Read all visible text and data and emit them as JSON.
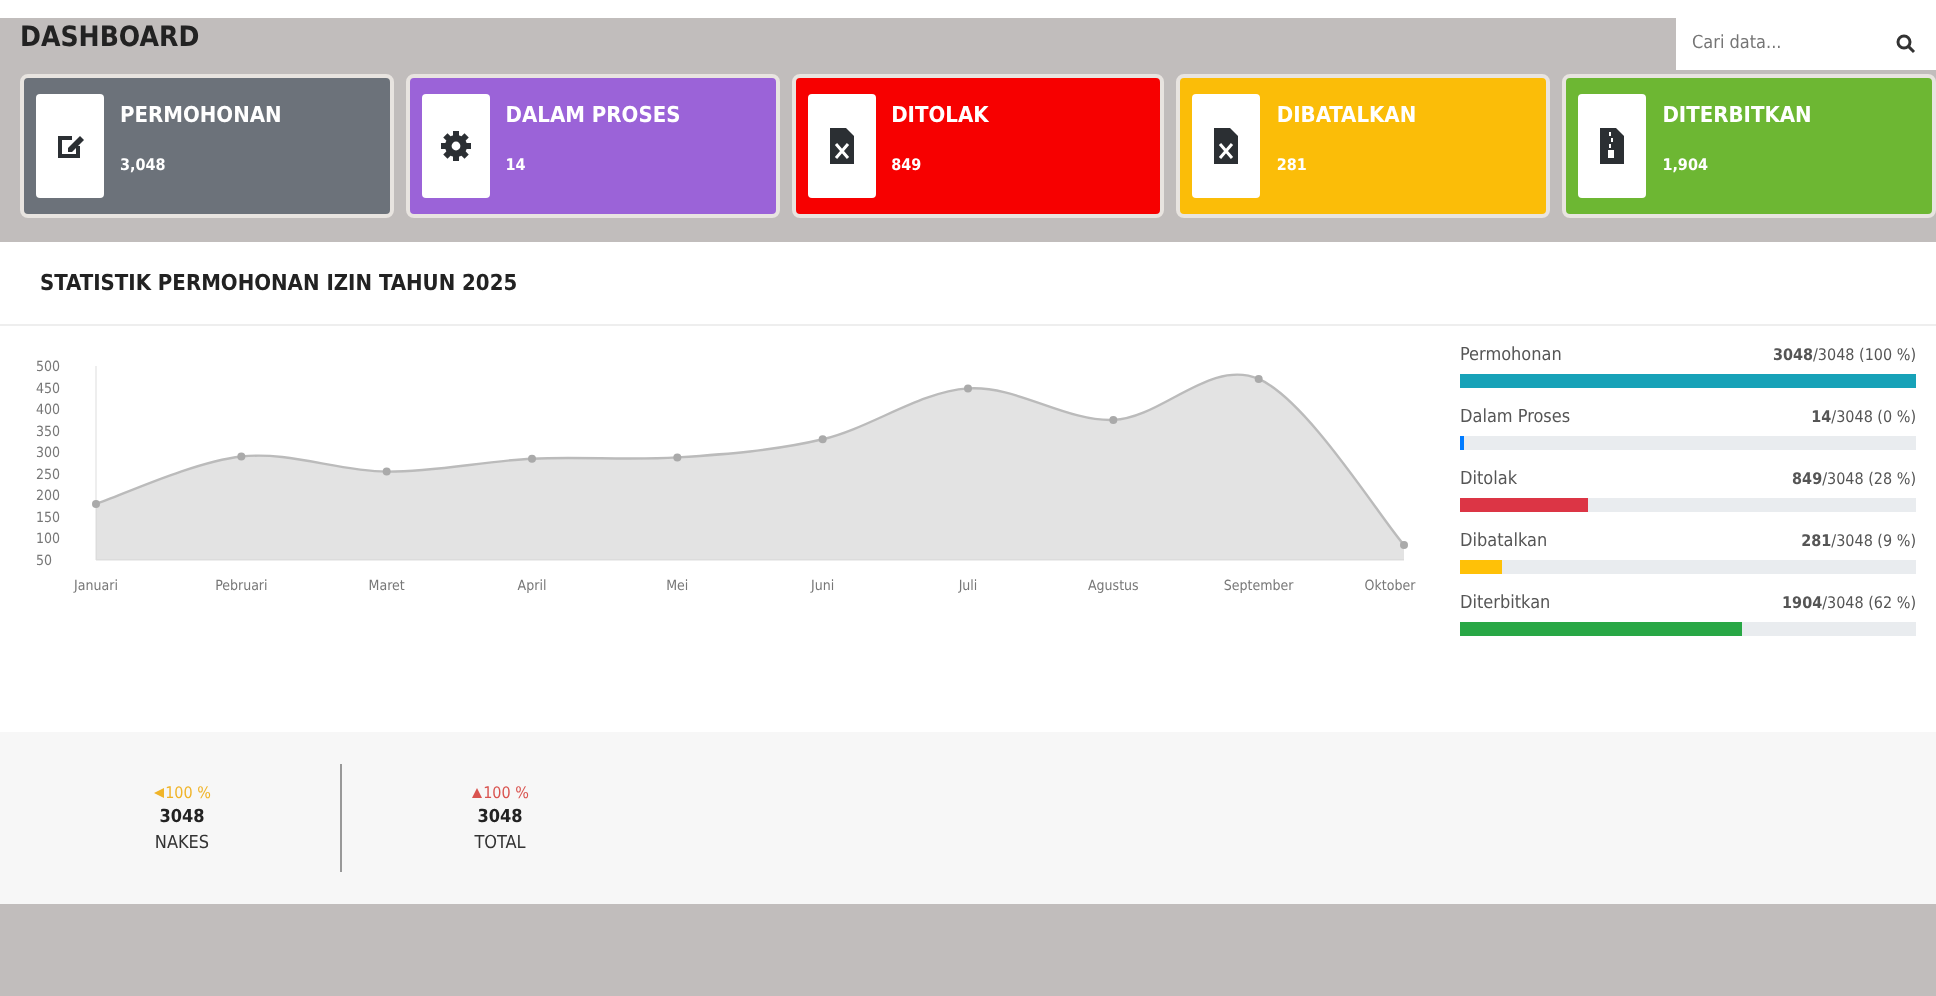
{
  "page_title": "DASHBOARD",
  "search": {
    "placeholder": "Cari data..."
  },
  "cards": [
    {
      "label": "PERMOHONAN",
      "value": "3,048",
      "kind": "edit",
      "color": "#6c727a"
    },
    {
      "label": "DALAM PROSES",
      "value": "14",
      "kind": "gear",
      "color": "#9b63d8"
    },
    {
      "label": "DITOLAK",
      "value": "849",
      "kind": "file-x",
      "color": "#f70000"
    },
    {
      "label": "DIBATALKAN",
      "value": "281",
      "kind": "file-x",
      "color": "#fbbd08"
    },
    {
      "label": "DITERBITKAN",
      "value": "1,904",
      "kind": "file-zip",
      "color": "#6db733"
    }
  ],
  "panel_title": "STATISTIK PERMOHONAN IZIN TAHUN 2025",
  "chart_data": {
    "type": "area",
    "categories": [
      "Januari",
      "Pebruari",
      "Maret",
      "April",
      "Mei",
      "Juni",
      "Juli",
      "Agustus",
      "September",
      "Oktober"
    ],
    "series": [
      {
        "color": "#d0d0d0",
        "values": [
          180,
          290,
          255,
          285,
          288,
          330,
          448,
          375,
          470,
          85
        ]
      }
    ],
    "ylim": [
      50,
      500
    ],
    "yticks": [
      50,
      100,
      150,
      200,
      250,
      300,
      350,
      400,
      450,
      500
    ]
  },
  "progress": [
    {
      "label": "Permohonan",
      "reading": "**3048**/3048 (100 %)",
      "level": 1,
      "color": "#17a2b8"
    },
    {
      "label": "Dalam Proses",
      "reading": "**14**/3048 (0 %)",
      "level": 0.005,
      "color": "#007bff"
    },
    {
      "label": "Ditolak",
      "reading": "**849**/3048 (28 %)",
      "level": 0.28,
      "color": "#dc3545"
    },
    {
      "label": "Dibatalkan",
      "reading": "**281**/3048 (9 %)",
      "level": 0.09,
      "color": "#ffc107"
    },
    {
      "label": "Diterbitkan",
      "reading": "**1904**/3048 (62 %)",
      "level": 0.62,
      "color": "#28a745"
    }
  ],
  "stats": [
    {
      "change": "100 %",
      "kind": "left",
      "color": "#f0b429",
      "value": "3048",
      "label": "NAKES"
    },
    {
      "change": "100 %",
      "kind": "up",
      "color": "#d9534f",
      "value": "3048",
      "label": "TOTAL"
    }
  ]
}
